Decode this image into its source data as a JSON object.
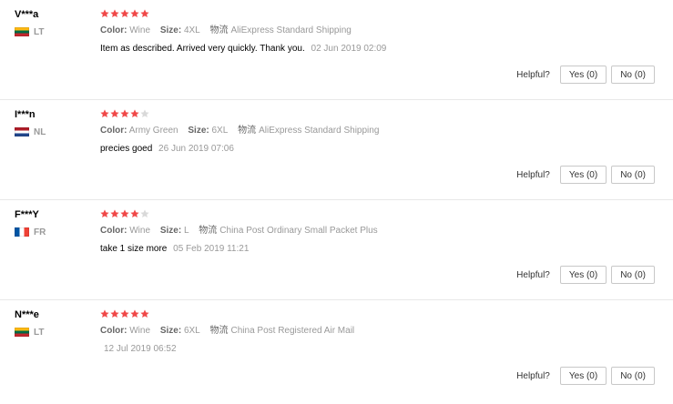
{
  "labels": {
    "color": "Color:",
    "size": "Size:",
    "shipping": "物流",
    "helpful": "Helpful?"
  },
  "colors": {
    "star_filled": "#f04848",
    "star_empty": "#d9d9d9"
  },
  "reviews": [
    {
      "user": "V***a",
      "country": "LT",
      "flag_icon": "lithuania-flag-icon",
      "rating": 5,
      "color": "Wine",
      "size": "4XL",
      "shipping": "AliExpress Standard Shipping",
      "text": "Item as described. Arrived very quickly. Thank you.",
      "date": "02 Jun 2019 02:09",
      "yes": "Yes (0)",
      "no": "No (0)"
    },
    {
      "user": "I***n",
      "country": "NL",
      "flag_icon": "netherlands-flag-icon",
      "rating": 4,
      "color": "Army Green",
      "size": "6XL",
      "shipping": "AliExpress Standard Shipping",
      "text": "precies goed",
      "date": "26 Jun 2019 07:06",
      "yes": "Yes (0)",
      "no": "No (0)"
    },
    {
      "user": "F***Y",
      "country": "FR",
      "flag_icon": "france-flag-icon",
      "rating": 4,
      "color": "Wine",
      "size": "L",
      "shipping": "China Post Ordinary Small Packet Plus",
      "text": "take 1 size more",
      "date": "05 Feb 2019 11:21",
      "yes": "Yes (0)",
      "no": "No (0)"
    },
    {
      "user": "N***e",
      "country": "LT",
      "flag_icon": "lithuania-flag-icon",
      "rating": 5,
      "color": "Wine",
      "size": "6XL",
      "shipping": "China Post Registered Air Mail",
      "text": "",
      "date": "12 Jul 2019 06:52",
      "yes": "Yes (0)",
      "no": "No (0)"
    }
  ]
}
